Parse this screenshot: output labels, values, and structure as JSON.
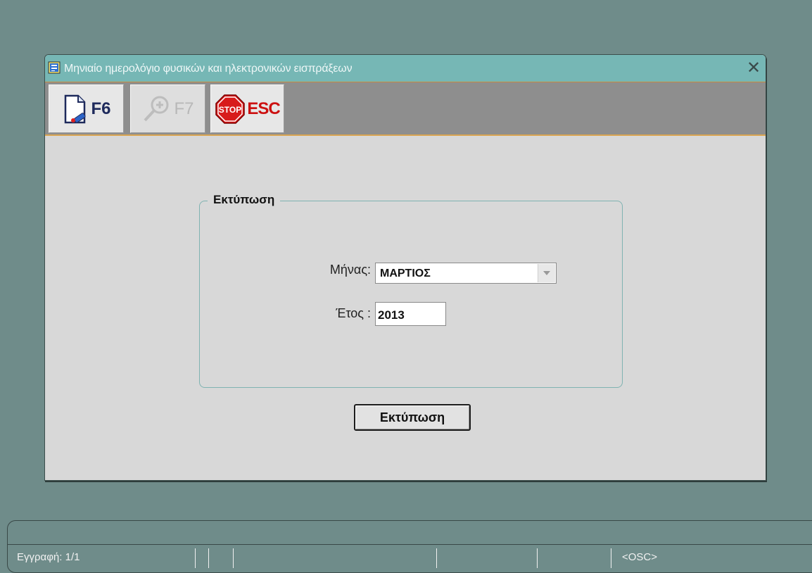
{
  "window": {
    "title": "Μηνιαίο ημερολόγιο φυσικών και ηλεκτρονικών εισπράξεων",
    "close_glyph": "✕"
  },
  "toolbar": {
    "buttons": [
      {
        "label": "F6",
        "icon": "new-document-icon",
        "enabled": true
      },
      {
        "label": "F7",
        "icon": "zoom-in-icon",
        "enabled": false
      },
      {
        "label": "ESC",
        "icon": "stop-sign-icon",
        "enabled": true
      }
    ],
    "stop_text": "STOP"
  },
  "form": {
    "group_title": "Εκτύπωση",
    "month_label": "Μήνας:",
    "month_value": "ΜΑΡΤΙΟΣ",
    "year_label": "Έτος :",
    "year_value": "2013",
    "print_button": "Εκτύπωση"
  },
  "statusbar": {
    "record": "Εγγραφή: 1/1",
    "mode": "<OSC>"
  },
  "colors": {
    "background": "#6f8c8a",
    "titlebar": "#76b7b5",
    "toolbar": "#8e8e8e",
    "accent": "#d9a451"
  }
}
